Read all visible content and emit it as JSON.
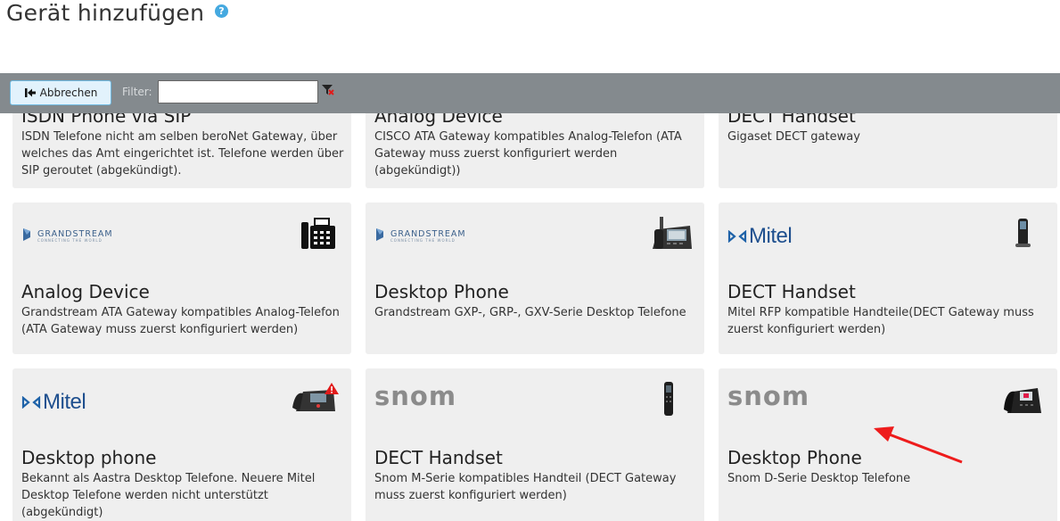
{
  "header": {
    "title": "Gerät hinzufügen",
    "help_icon": "question-circle-icon"
  },
  "toolbar": {
    "cancel_label": "Abbrechen",
    "filter_label": "Filter:",
    "filter_value": "",
    "filter_placeholder": ""
  },
  "brands": {
    "grandstream": "GRANDSTREAM",
    "grandstream_tagline": "CONNECTING THE WORLD",
    "mitel": "Mitel",
    "snom": "snom"
  },
  "cards": [
    {
      "title": "ISDN Phone via SIP",
      "description": "ISDN Telefone nicht am selben beroNet Gateway, über welches das Amt eingerichtet ist. Telefone werden über SIP geroutet (abgekündigt)."
    },
    {
      "title": "Analog Device",
      "description": "CISCO ATA Gateway kompatibles Analog-Telefon (ATA Gateway muss zuerst konfiguriert werden (abgekündigt))"
    },
    {
      "title": "DECT Handset",
      "description": "Gigaset DECT gateway"
    },
    {
      "title": "Analog Device",
      "description": "Grandstream ATA Gateway kompatibles Analog-Telefon (ATA Gateway muss zuerst konfiguriert werden)",
      "brand": "Grandstream",
      "icon": "fax-machine-icon"
    },
    {
      "title": "Desktop Phone",
      "description": "Grandstream GXP-, GRP-, GXV-Serie Desktop Telefone",
      "brand": "Grandstream",
      "icon": "desk-phone-icon"
    },
    {
      "title": "DECT Handset",
      "description": "Mitel RFP kompatible Handteile(DECT Gateway muss zuerst konfiguriert werden)",
      "brand": "Mitel",
      "icon": "dect-handset-icon"
    },
    {
      "title": "Desktop phone",
      "description": "Bekannt als Aastra Desktop Telefone. Neuere Mitel Desktop Telefone werden nicht unterstützt (abgekündigt)",
      "brand": "Mitel",
      "icon": "desk-phone-warning-icon"
    },
    {
      "title": "DECT Handset",
      "description": "Snom M-Serie kompatibles Handteil (DECT Gateway muss zuerst konfiguriert werden)",
      "brand": "snom",
      "icon": "dect-handset-icon"
    },
    {
      "title": "Desktop Phone",
      "description": "Snom D-Serie Desktop Telefone",
      "brand": "snom",
      "icon": "desk-phone-icon"
    }
  ],
  "annotation": {
    "arrow_color": "#ee1c1c",
    "points_to": "Desktop Phone (snom)"
  }
}
